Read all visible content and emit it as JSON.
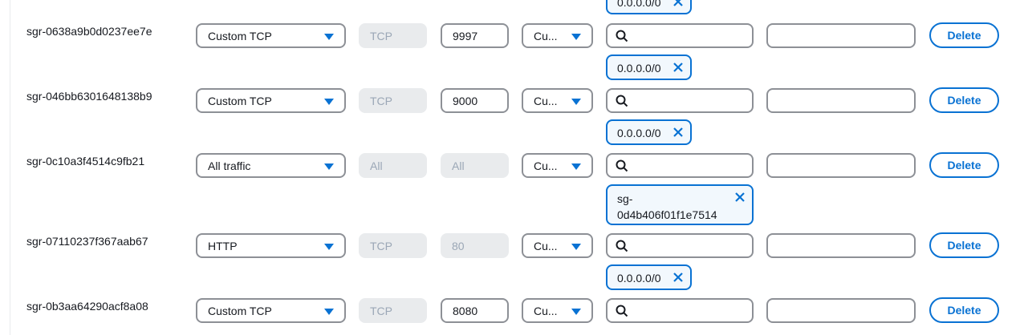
{
  "rows": [
    {
      "id": "sgr-0638a9b0d0237ee7e",
      "type": "Custom TCP",
      "protocol": "TCP",
      "port": "9997",
      "source_type": "Cu...",
      "delete_label": "Delete"
    },
    {
      "id": "sgr-046bb6301648138b9",
      "type": "Custom TCP",
      "protocol": "TCP",
      "port": "9000",
      "source_type": "Cu...",
      "delete_label": "Delete"
    },
    {
      "id": "sgr-0c10a3f4514c9fb21",
      "type": "All traffic",
      "protocol": "All",
      "port": "All",
      "source_type": "Cu...",
      "delete_label": "Delete"
    },
    {
      "id": "sgr-07110237f367aab67",
      "type": "HTTP",
      "protocol": "TCP",
      "port": "80",
      "source_type": "Cu...",
      "delete_label": "Delete"
    },
    {
      "id": "sgr-0b3aa64290acf8a08",
      "type": "Custom TCP",
      "protocol": "TCP",
      "port": "8080",
      "source_type": "Cu...",
      "delete_label": "Delete"
    }
  ],
  "tokens": [
    {
      "value": "0.0.0.0/0"
    },
    {
      "value": "0.0.0.0/0"
    },
    {
      "value": "0.0.0.0/0"
    },
    {
      "value": "sg-\n0d4b406f01f1e7514"
    },
    {
      "value": "0.0.0.0/0"
    }
  ],
  "icons": {
    "search": "search-icon",
    "remove": "close-icon",
    "dropdown": "caret-down-icon"
  },
  "colors": {
    "accent": "#0972d3",
    "border": "#8d9096",
    "disabled_bg": "#e9ebed",
    "token_bg": "#f2f8fd"
  }
}
